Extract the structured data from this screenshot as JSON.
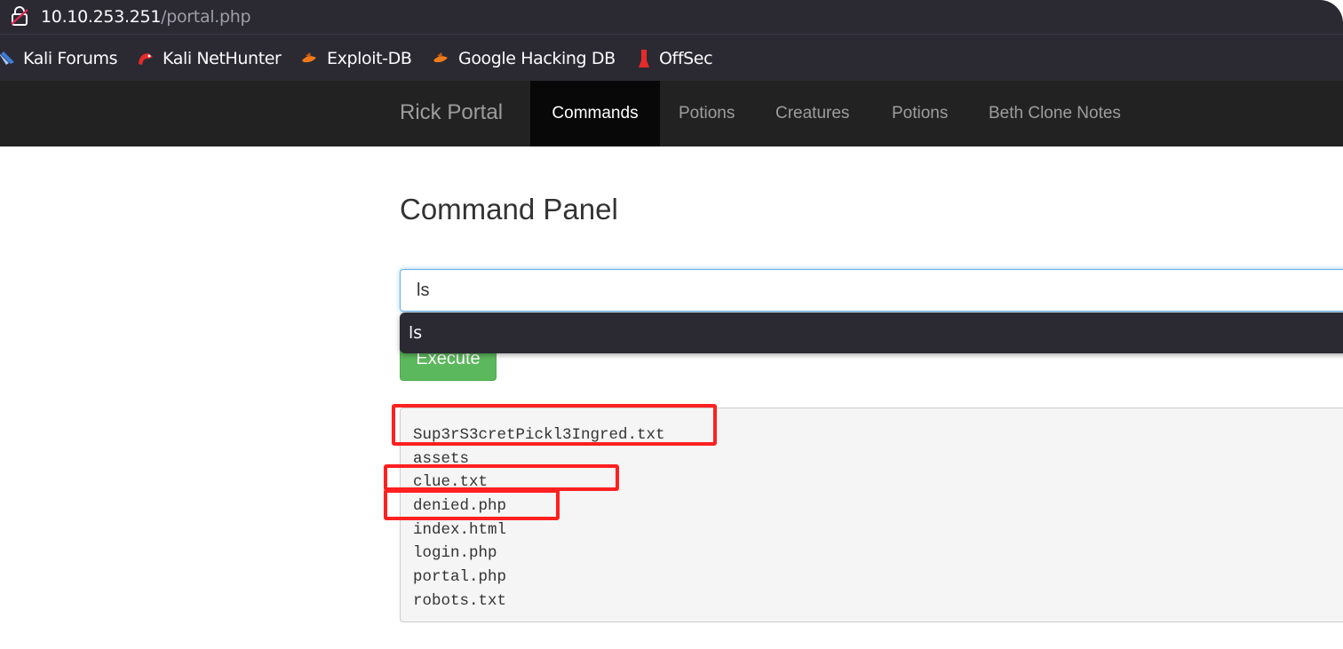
{
  "browser": {
    "url_host": "10.10.253.251",
    "url_path": "/portal.php",
    "bookmarks": [
      {
        "label": "Kali Forums",
        "icon": "kali-forums-icon"
      },
      {
        "label": "Kali NetHunter",
        "icon": "kali-nethunter-icon"
      },
      {
        "label": "Exploit-DB",
        "icon": "exploit-db-icon"
      },
      {
        "label": "Google Hacking DB",
        "icon": "google-hacking-db-icon"
      },
      {
        "label": "OffSec",
        "icon": "offsec-icon"
      }
    ]
  },
  "navbar": {
    "brand": "Rick Portal",
    "items": [
      {
        "label": "Commands",
        "active": true
      },
      {
        "label": "Potions",
        "active": false
      },
      {
        "label": "Creatures",
        "active": false
      },
      {
        "label": "Potions",
        "active": false
      },
      {
        "label": "Beth Clone Notes",
        "active": false
      }
    ]
  },
  "page": {
    "title": "Command Panel",
    "command_value": "ls",
    "autocomplete_suggestion": "ls",
    "execute_label": "Execute",
    "output_lines": [
      "Sup3rS3cretPickl3Ingred.txt",
      "assets",
      "clue.txt",
      "denied.php",
      "index.html",
      "login.php",
      "portal.php",
      "robots.txt"
    ],
    "highlighted_lines": [
      "Sup3rS3cretPickl3Ingred.txt",
      "clue.txt",
      "denied.php"
    ]
  },
  "colors": {
    "browser_chrome": "#2b2a33",
    "navbar": "#222222",
    "navbar_active": "#080808",
    "execute_button": "#5cb85c",
    "highlight": "#ff2020"
  }
}
